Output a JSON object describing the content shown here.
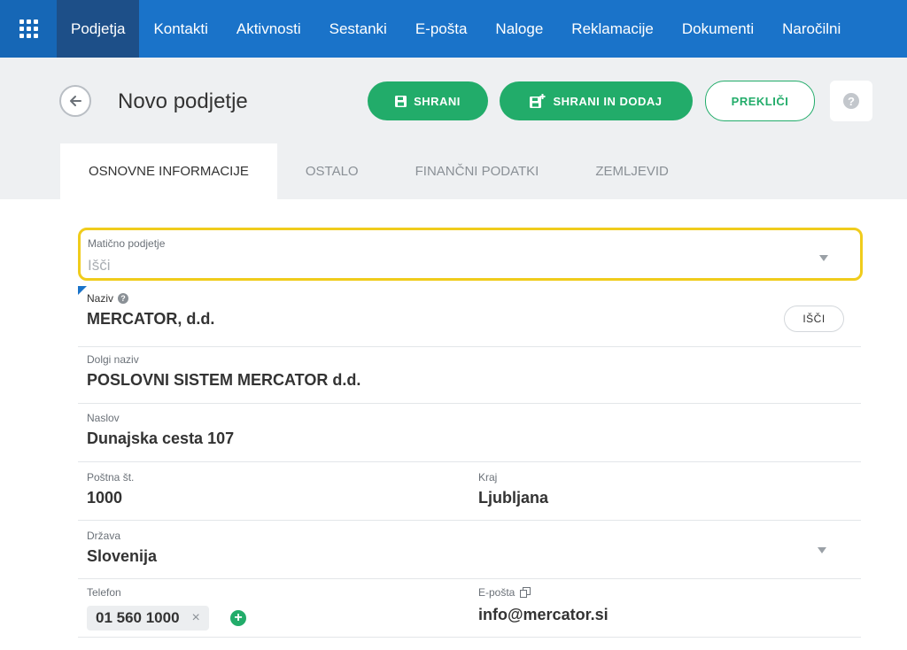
{
  "nav": {
    "items": [
      "Podjetja",
      "Kontakti",
      "Aktivnosti",
      "Sestanki",
      "E-pošta",
      "Naloge",
      "Reklamacije",
      "Dokumenti",
      "Naročilni"
    ],
    "active_index": 0
  },
  "header": {
    "title": "Novo podjetje",
    "save_label": "SHRANI",
    "save_add_label": "SHRANI IN DODAJ",
    "cancel_label": "PREKLIČI",
    "help_label": "?"
  },
  "tabs": [
    "OSNOVNE INFORMACIJE",
    "OSTALO",
    "FINANČNI PODATKI",
    "ZEMLJEVID"
  ],
  "form": {
    "parent": {
      "label": "Matično podjetje",
      "placeholder": "Išči"
    },
    "name": {
      "label": "Naziv",
      "value": "MERCATOR, d.d.",
      "search_label": "IŠČI"
    },
    "long_name": {
      "label": "Dolgi naziv",
      "value": "POSLOVNI SISTEM MERCATOR d.d."
    },
    "address": {
      "label": "Naslov",
      "value": "Dunajska cesta 107"
    },
    "postal": {
      "label": "Poštna št.",
      "value": "1000"
    },
    "city": {
      "label": "Kraj",
      "value": "Ljubljana"
    },
    "country": {
      "label": "Država",
      "value": "Slovenija"
    },
    "phone": {
      "label": "Telefon",
      "value": "01 560 1000"
    },
    "email": {
      "label": "E-pošta",
      "value": "info@mercator.si"
    }
  },
  "colors": {
    "nav": "#1a73c9",
    "accent_green": "#22ac6a",
    "highlight": "#f0cc1c"
  }
}
